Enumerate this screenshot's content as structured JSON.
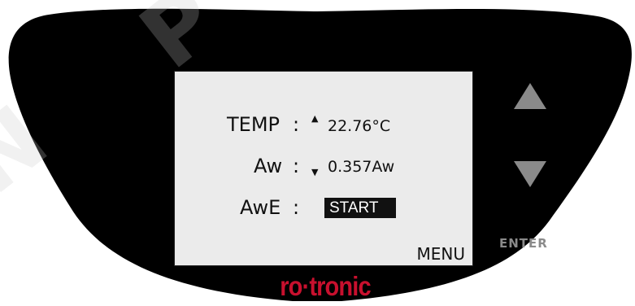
{
  "display": {
    "rows": [
      {
        "label": "TEMP",
        "separator": ":",
        "trend": "▲",
        "value": "22.76",
        "unit": "°C"
      },
      {
        "label": "Aw",
        "separator": ":",
        "trend": "▼",
        "value": "0.357",
        "unit": "Aw"
      },
      {
        "label": "AwE",
        "separator": ":",
        "action": "START"
      }
    ],
    "menu_label": "MENU"
  },
  "buttons": {
    "up_icon": "triangle-up",
    "down_icon": "triangle-down",
    "enter_label": "ENTER"
  },
  "brand": {
    "name": "ro·tronic",
    "color": "#c8102e"
  },
  "colors": {
    "bezel": "#000000",
    "lcd_background": "#ebebeb",
    "button_gray": "#8a8a8a"
  }
}
